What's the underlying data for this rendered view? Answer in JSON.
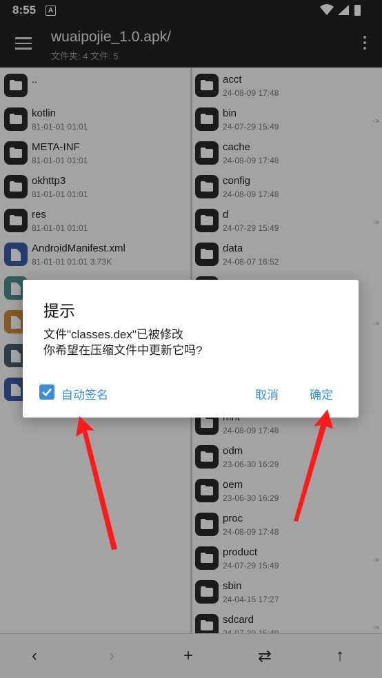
{
  "status": {
    "time": "8:55",
    "notif_glyph": "A"
  },
  "toolbar": {
    "title": "wuaipojie_1.0.apk/",
    "subtitle": "文件夹: 4  文件: 5"
  },
  "left_pane": [
    {
      "name": "..",
      "date": "",
      "type": "folder"
    },
    {
      "name": "kotlin",
      "date": "81-01-01 01:01",
      "type": "folder"
    },
    {
      "name": "META-INF",
      "date": "81-01-01 01:01",
      "type": "folder"
    },
    {
      "name": "okhttp3",
      "date": "81-01-01 01:01",
      "type": "folder"
    },
    {
      "name": "res",
      "date": "81-01-01 01:01",
      "type": "folder"
    },
    {
      "name": "AndroidManifest.xml",
      "date": "81-01-01 01:01  3.73K",
      "type": "xml"
    },
    {
      "name": "",
      "date": "",
      "type": "dex"
    },
    {
      "name": "",
      "date": "",
      "type": "layers"
    },
    {
      "name": "",
      "date": "",
      "type": "doc"
    },
    {
      "name": "",
      "date": "",
      "type": "doc-blue"
    }
  ],
  "right_pane": [
    {
      "name": "acct",
      "date": "24-08-09 17:48",
      "link": ""
    },
    {
      "name": "bin",
      "date": "24-07-29 15:49",
      "link": "->"
    },
    {
      "name": "cache",
      "date": "24-08-09 17:48",
      "link": ""
    },
    {
      "name": "config",
      "date": "24-08-09 17:48",
      "link": ""
    },
    {
      "name": "d",
      "date": "24-07-29 15:49",
      "link": "->"
    },
    {
      "name": "data",
      "date": "24-08-07 16:52",
      "link": ""
    },
    {
      "name": "",
      "date": "",
      "link": ""
    },
    {
      "name": "",
      "date": "",
      "link": "->"
    },
    {
      "name": "",
      "date": "",
      "link": ""
    },
    {
      "name": "",
      "date": "",
      "link": ""
    },
    {
      "name": "mnt",
      "date": "24-08-09 17:48",
      "link": ""
    },
    {
      "name": "odm",
      "date": "23-06-30 16:29",
      "link": ""
    },
    {
      "name": "oem",
      "date": "23-06-30 16:29",
      "link": ""
    },
    {
      "name": "proc",
      "date": "24-08-09 17:48",
      "link": ""
    },
    {
      "name": "product",
      "date": "24-07-29 15:49",
      "link": "->"
    },
    {
      "name": "sbin",
      "date": "24-04-15 17:27",
      "link": ""
    },
    {
      "name": "sdcard",
      "date": "24-07-29 15:49",
      "link": "->"
    }
  ],
  "bottom_bar": {
    "back": "‹",
    "forward": "›",
    "add": "+",
    "swap": "⇄",
    "up": "↑"
  },
  "dialog": {
    "title": "提示",
    "message_line1": "文件\"classes.dex\"已被修改",
    "message_line2": "你希望在压缩文件中更新它吗?",
    "checkbox_label": "自动签名",
    "checkbox_checked": true,
    "cancel_label": "取消",
    "ok_label": "确定"
  },
  "colors": {
    "accent": "#3b8ed8",
    "toolbar": "#222222",
    "arrow": "#ff1a1a"
  }
}
